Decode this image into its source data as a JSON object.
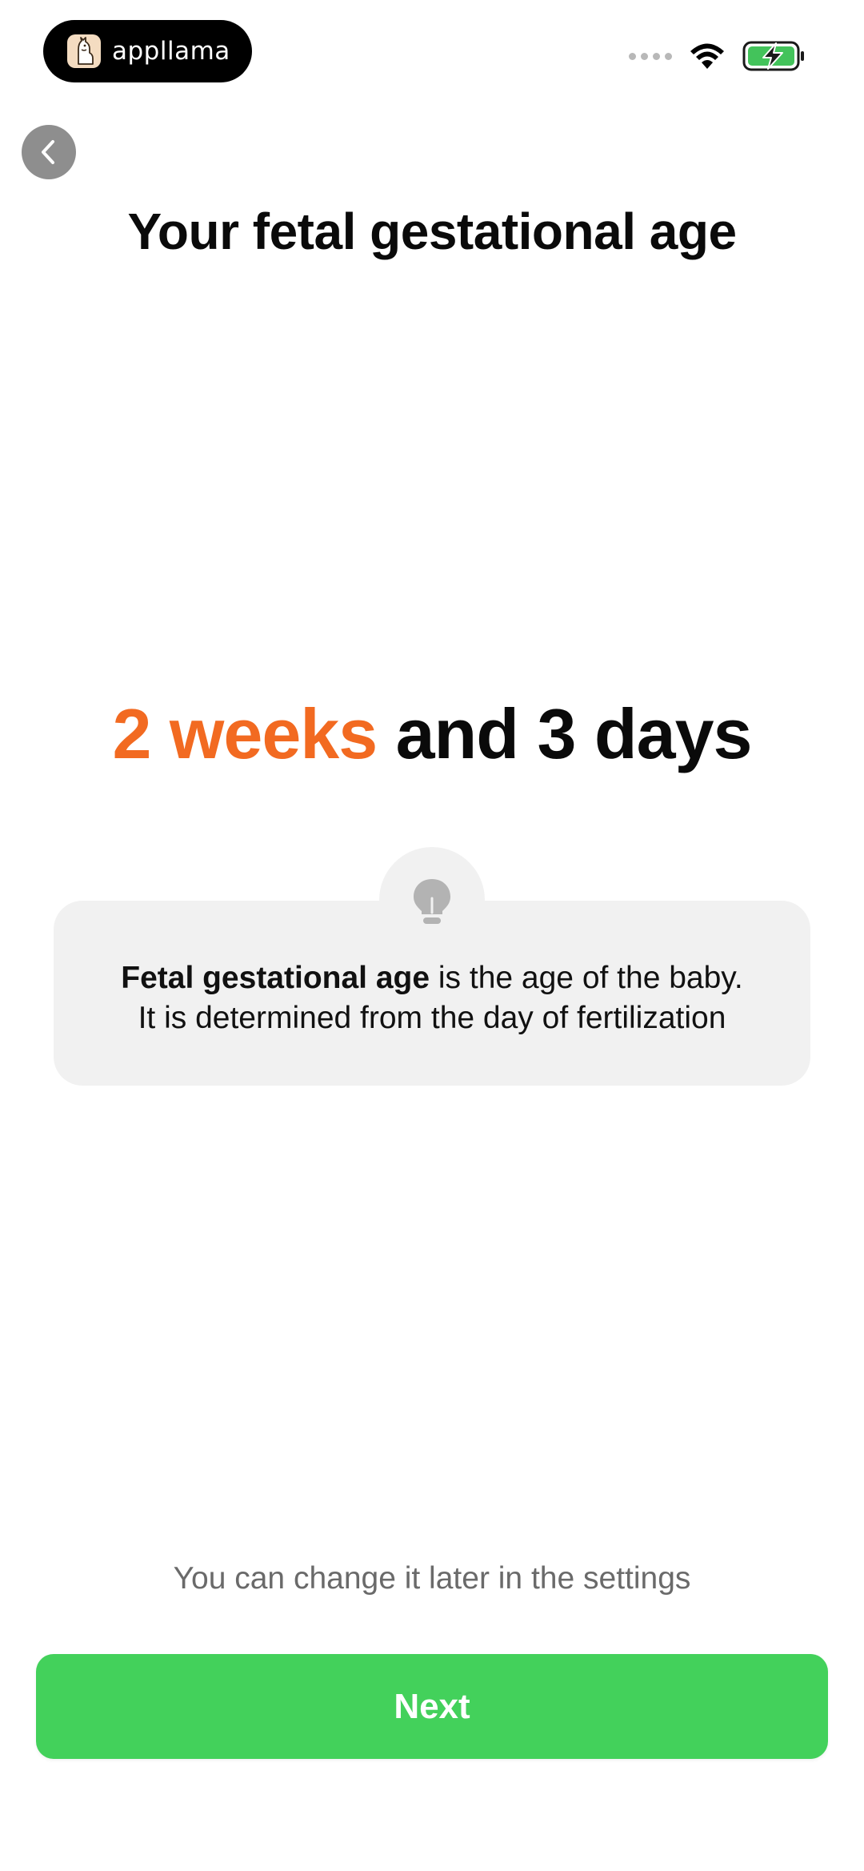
{
  "status_bar": {
    "brand_name": "appllama",
    "icons": [
      "llama-logo-icon",
      "signal-dots-icon",
      "wifi-icon",
      "battery-charging-icon"
    ]
  },
  "navigation": {
    "back_icon": "chevron-left-icon"
  },
  "header": {
    "title": "Your fetal gestational age"
  },
  "age": {
    "weeks_text": "2 weeks",
    "rest_text": " and 3 days"
  },
  "tip": {
    "icon": "lightbulb-icon",
    "bold_term": "Fetal gestational age",
    "line1_rest": " is the age of the baby.",
    "line2": "It is determined from the day of fertilization"
  },
  "footer": {
    "hint": "You can change it later in the settings",
    "next_label": "Next"
  },
  "colors": {
    "accent_orange": "#f26a21",
    "button_green": "#43d15b",
    "card_gray": "#f1f1f1",
    "back_button_gray": "#8e8e8e"
  }
}
